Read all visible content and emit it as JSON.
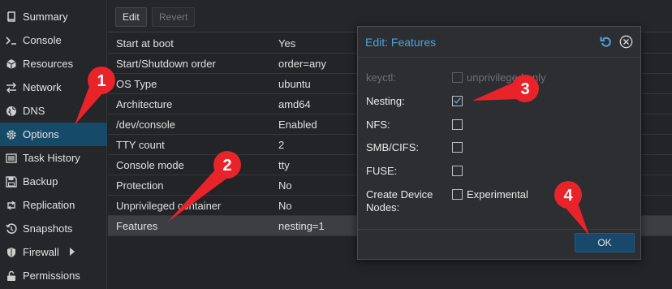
{
  "sidebar": {
    "items": [
      {
        "label": "Summary",
        "icon": "book-icon"
      },
      {
        "label": "Console",
        "icon": "terminal-icon"
      },
      {
        "label": "Resources",
        "icon": "cube-icon"
      },
      {
        "label": "Network",
        "icon": "exchange-icon"
      },
      {
        "label": "DNS",
        "icon": "globe-icon"
      },
      {
        "label": "Options",
        "icon": "gear-icon"
      },
      {
        "label": "Task History",
        "icon": "list-icon"
      },
      {
        "label": "Backup",
        "icon": "floppy-icon"
      },
      {
        "label": "Replication",
        "icon": "retweet-icon"
      },
      {
        "label": "Snapshots",
        "icon": "history-icon"
      },
      {
        "label": "Firewall",
        "icon": "shield-icon",
        "has_chevron": true
      },
      {
        "label": "Permissions",
        "icon": "unlock-icon"
      }
    ],
    "active_index": 5
  },
  "toolbar": {
    "edit_label": "Edit",
    "revert_label": "Revert"
  },
  "options": {
    "rows": [
      {
        "key": "Start at boot",
        "value": "Yes"
      },
      {
        "key": "Start/Shutdown order",
        "value": "order=any"
      },
      {
        "key": "OS Type",
        "value": "ubuntu"
      },
      {
        "key": "Architecture",
        "value": "amd64"
      },
      {
        "key": "/dev/console",
        "value": "Enabled"
      },
      {
        "key": "TTY count",
        "value": "2"
      },
      {
        "key": "Console mode",
        "value": "tty"
      },
      {
        "key": "Protection",
        "value": "No"
      },
      {
        "key": "Unprivileged container",
        "value": "No"
      },
      {
        "key": "Features",
        "value": "nesting=1"
      }
    ],
    "selected_index": 9
  },
  "dialog": {
    "title": "Edit: Features",
    "fields": {
      "keyctl": {
        "label": "keyctl:",
        "checkbox_text": "unprivileged only",
        "checked": false,
        "disabled": true
      },
      "nesting": {
        "label": "Nesting:",
        "checked": true
      },
      "nfs": {
        "label": "NFS:",
        "checked": false
      },
      "smb": {
        "label": "SMB/CIFS:",
        "checked": false
      },
      "fuse": {
        "label": "FUSE:",
        "checked": false
      },
      "mknod": {
        "label_line1": "Create Device",
        "label_line2": "Nodes:",
        "checkbox_text": "Experimental",
        "checked": false
      }
    },
    "ok_label": "OK"
  },
  "callouts": [
    "1",
    "2",
    "3",
    "4"
  ],
  "colors": {
    "accent": "#4ea1dd",
    "active_nav": "#154a69",
    "callout": "#e8232a"
  }
}
